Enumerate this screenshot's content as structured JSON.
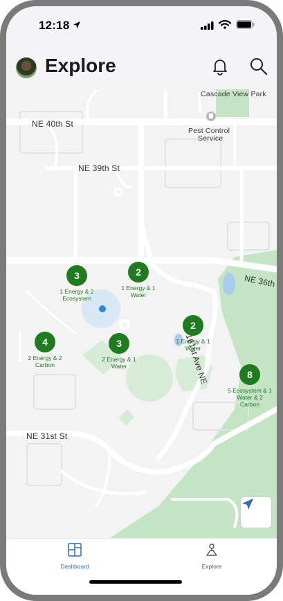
{
  "status_bar": {
    "time": "12:18"
  },
  "header": {
    "title": "Explore"
  },
  "map": {
    "labels": {
      "cascade_view_park": "Cascade View Park",
      "pest_control_line1": "Pest Control",
      "pest_control_line2": "Service",
      "ne_40th": "NE 40th St",
      "ne_39th": "NE 39th St",
      "ne_36th": "NE 36th",
      "ne_31st": "NE 31st St",
      "ave_161st": "161st Ave NE"
    },
    "clusters": [
      {
        "count": "3",
        "line1": "1 Energy & 2",
        "line2": "Ecosystem"
      },
      {
        "count": "2",
        "line1": "1 Energy & 1",
        "line2": "Water"
      },
      {
        "count": "4",
        "line1": "2 Energy & 2",
        "line2": "Carbon"
      },
      {
        "count": "3",
        "line1": "2 Energy & 1",
        "line2": "Water"
      },
      {
        "count": "2",
        "line1": "1 Energy & 1",
        "line2": "Water"
      },
      {
        "count": "8",
        "line1": "5 Ecosystem & 1",
        "line2": "Water & 2",
        "line3": "Carbon"
      }
    ]
  },
  "tabbar": {
    "dashboard": "Dashboard",
    "explore": "Explore"
  },
  "colors": {
    "accent": "#1e7b1e",
    "tab_active": "#2f6fb6"
  }
}
